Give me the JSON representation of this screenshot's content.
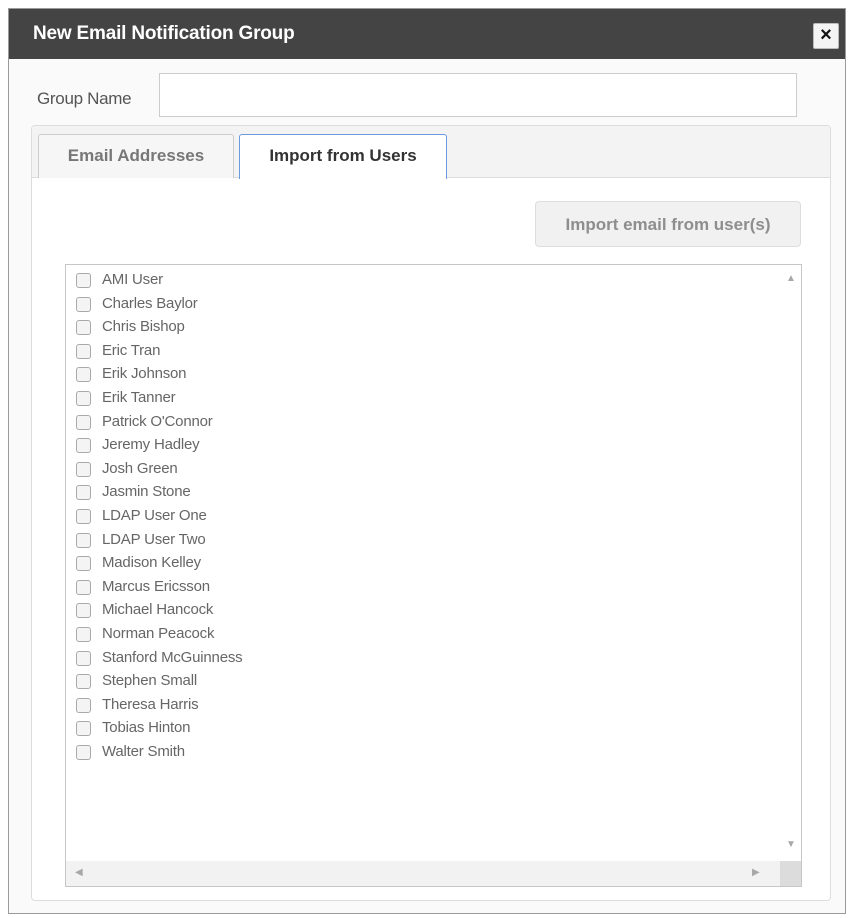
{
  "dialog": {
    "title": "New Email Notification Group",
    "close_label": "×"
  },
  "form": {
    "group_name_label": "Group Name",
    "group_name_value": ""
  },
  "tabs": [
    {
      "label": "Email Addresses",
      "active": false
    },
    {
      "label": "Import from Users",
      "active": true
    }
  ],
  "import_button": {
    "label": "Import email from user(s)",
    "disabled": true
  },
  "users": [
    "AMI User",
    "Charles Baylor",
    "Chris Bishop",
    "Eric Tran",
    "Erik Johnson",
    "Erik Tanner",
    "Patrick O'Connor",
    "Jeremy Hadley",
    "Josh Green",
    "Jasmin Stone",
    "LDAP User One",
    "LDAP User Two",
    "Madison Kelley",
    "Marcus Ericsson",
    "Michael Hancock",
    "Norman Peacock",
    "Stanford McGuinness",
    "Stephen Small",
    "Theresa Harris",
    "Tobias Hinton",
    "Walter Smith"
  ],
  "icons": {
    "close": "close-icon",
    "scroll_up": "scroll-up-arrow-icon",
    "scroll_down": "scroll-down-arrow-icon",
    "scroll_left": "scroll-left-arrow-icon",
    "scroll_right": "scroll-right-arrow-icon"
  },
  "colors": {
    "titlebar": "#444444",
    "active_tab_border": "#6a9be0"
  }
}
